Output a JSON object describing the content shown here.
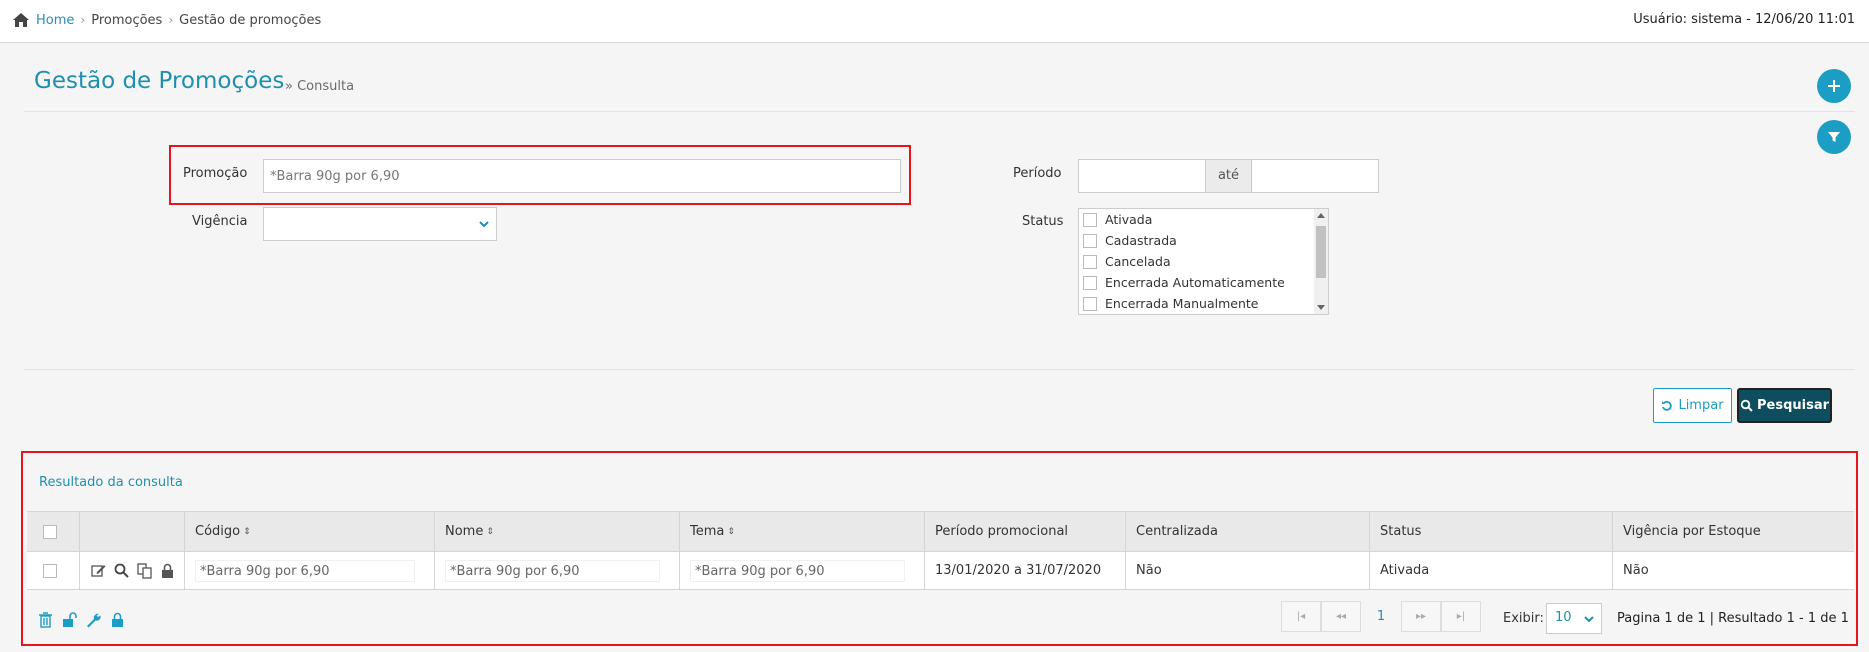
{
  "breadcrumb": {
    "home": "Home",
    "items": [
      "Promoções",
      "Gestão de promoções"
    ]
  },
  "user_info": "Usuário: sistema - 12/06/20 11:01",
  "page": {
    "title": "Gestão de Promoções",
    "subtitle": "Consulta"
  },
  "filters": {
    "promocao_label": "Promoção",
    "promocao_value": "*Barra 90g por 6,90",
    "vigencia_label": "Vigência",
    "vigencia_value": "",
    "periodo_label": "Período",
    "periodo_ate": "até",
    "periodo_from": "",
    "periodo_to": "",
    "status_label": "Status",
    "status_options": [
      "Ativada",
      "Cadastrada",
      "Cancelada",
      "Encerrada Automaticamente",
      "Encerrada Manualmente"
    ]
  },
  "buttons": {
    "limpar": "Limpar",
    "pesquisar": "Pesquisar"
  },
  "results": {
    "title": "Resultado da consulta",
    "columns": [
      "Código",
      "Nome",
      "Tema",
      "Período promocional",
      "Centralizada",
      "Status",
      "Vigência por Estoque"
    ],
    "rows": [
      {
        "codigo": "*Barra 90g por 6,90",
        "nome": "*Barra 90g por 6,90",
        "tema": "*Barra 90g por 6,90",
        "periodo": "13/01/2020 a 31/07/2020",
        "centralizada": "Não",
        "status": "Ativada",
        "vigencia_estoque": "Não"
      }
    ]
  },
  "pagination": {
    "current_page": "1",
    "exibir_label": "Exibir:",
    "exibir_value": "10",
    "info": "Pagina 1 de 1 | Resultado 1 - 1 de 1"
  },
  "colors": {
    "accent": "#1c9ec4",
    "title": "#1f8fb0",
    "highlight": "#e5151e",
    "primary_dark": "#0d4d5e"
  }
}
